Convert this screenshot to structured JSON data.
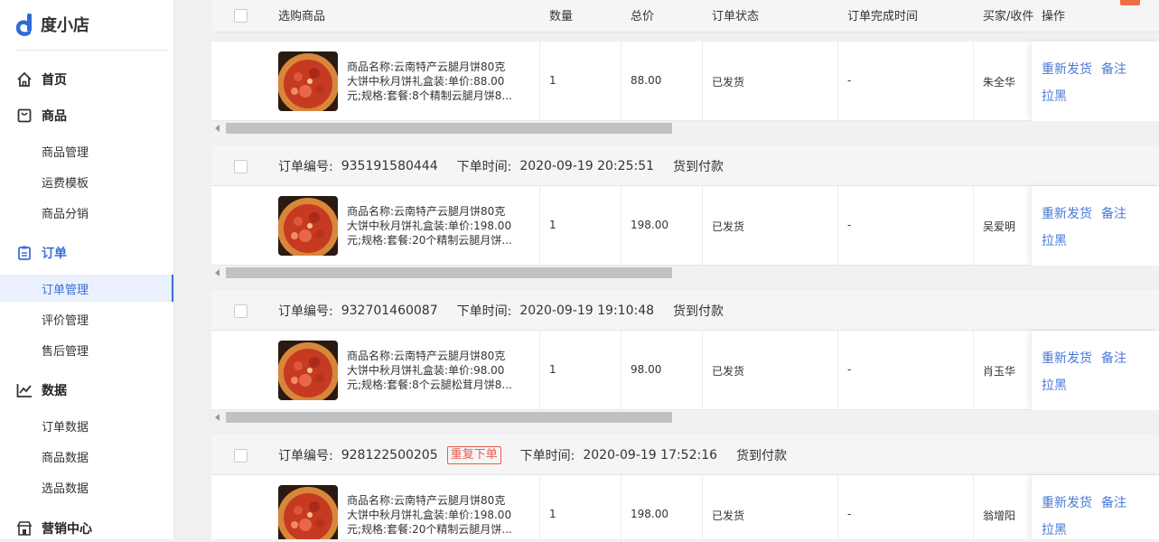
{
  "app": {
    "name": "度小店"
  },
  "sidebar": {
    "groups": [
      {
        "label": "首页",
        "icon": "home-icon"
      },
      {
        "label": "商品",
        "icon": "bag-icon",
        "items": [
          "商品管理",
          "运费模板",
          "商品分销"
        ]
      },
      {
        "label": "订单",
        "icon": "clipboard-icon",
        "items": [
          "订单管理",
          "评价管理",
          "售后管理"
        ]
      },
      {
        "label": "数据",
        "icon": "chart-icon",
        "items": [
          "订单数据",
          "商品数据",
          "选品数据"
        ]
      },
      {
        "label": "营销中心",
        "icon": "store-icon"
      }
    ],
    "active_item": "订单管理"
  },
  "table": {
    "columns": [
      "选购商品",
      "数量",
      "总价",
      "订单状态",
      "订单完成时间",
      "买家/收件",
      "操作"
    ]
  },
  "labels": {
    "order_no": "订单编号:",
    "order_time": "下单时间:",
    "duplicate_badge": "重复下单"
  },
  "actions": {
    "resend": "重新发货",
    "note": "备注",
    "block": "拉黑"
  },
  "orders": [
    {
      "order_no": "",
      "order_time": "",
      "payment": "",
      "duplicate": false,
      "product_lines": [
        "商品名称:云南特产云腿月饼80克",
        "大饼中秋月饼礼盒装:单价:88.00",
        "元;规格:套餐:8个精制云腿月饼8..."
      ],
      "qty": "1",
      "total": "88.00",
      "status": "已发货",
      "done_time": "-",
      "buyer": "朱全华"
    },
    {
      "order_no": "935191580444",
      "order_time": "2020-09-19 20:25:51",
      "payment": "货到付款",
      "duplicate": false,
      "product_lines": [
        "商品名称:云南特产云腿月饼80克",
        "大饼中秋月饼礼盒装:单价:198.00",
        "元;规格:套餐:20个精制云腿月饼..."
      ],
      "qty": "1",
      "total": "198.00",
      "status": "已发货",
      "done_time": "-",
      "buyer": "吴爱明"
    },
    {
      "order_no": "932701460087",
      "order_time": "2020-09-19 19:10:48",
      "payment": "货到付款",
      "duplicate": false,
      "product_lines": [
        "商品名称:云南特产云腿月饼80克",
        "大饼中秋月饼礼盒装:单价:98.00",
        "元;规格:套餐:8个云腿松茸月饼8..."
      ],
      "qty": "1",
      "total": "98.00",
      "status": "已发货",
      "done_time": "-",
      "buyer": "肖玉华"
    },
    {
      "order_no": "928122500205",
      "order_time": "2020-09-19 17:52:16",
      "payment": "货到付款",
      "duplicate": true,
      "product_lines": [
        "商品名称:云南特产云腿月饼80克",
        "大饼中秋月饼礼盒装:单价:198.00",
        "元;规格:套餐:20个精制云腿月饼..."
      ],
      "qty": "1",
      "total": "198.00",
      "status": "已发货",
      "done_time": "-",
      "buyer": "翁增阳"
    }
  ],
  "colors": {
    "accent": "#3a6fd8",
    "link": "#4a78d6",
    "danger": "#e85a4f"
  }
}
